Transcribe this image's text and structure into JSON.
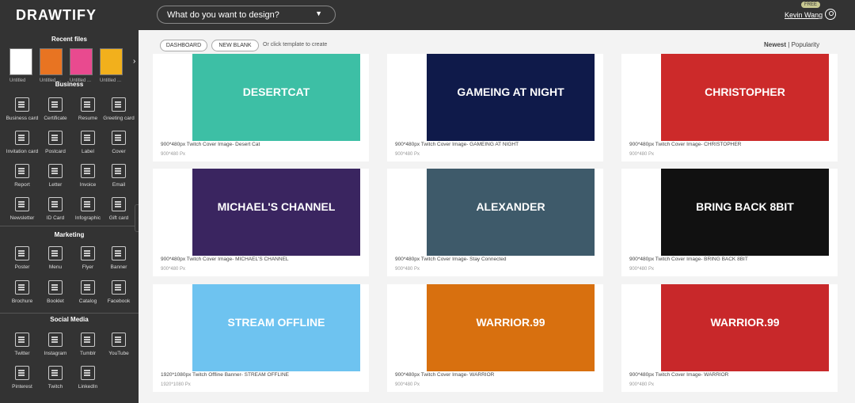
{
  "header": {
    "logo": "DRAWTIFY",
    "search_placeholder": "What do you want to design?",
    "badge": "FREE",
    "user": "Kevin Wang"
  },
  "sidebar": {
    "recent_title": "Recent files",
    "recent_label": "Untitled ...",
    "untitled_short": "Untitled",
    "business": "Business",
    "marketing": "Marketing",
    "social": "Social Media",
    "items": [
      "Business card",
      "Certificate",
      "Resume",
      "Greeting card",
      "Invitation card",
      "Postcard",
      "Label",
      "Cover",
      "Report",
      "Letter",
      "Invoice",
      "Email",
      "Newsletter",
      "ID Card",
      "Infographic",
      "Gift card",
      "Poster",
      "Menu",
      "Flyer",
      "Banner",
      "Brochure",
      "Booklet",
      "Catalog",
      "Facebook",
      "Twitter",
      "Instagram",
      "Tumblr",
      "YouTube",
      "Pinterest",
      "Twitch",
      "LinkedIn"
    ]
  },
  "main": {
    "dashboard": "DASHBOARD",
    "new_blank": "NEW BLANK",
    "or_text": "Or click template to create",
    "newest": "Newest",
    "sep": "|",
    "popularity": "Popularity"
  },
  "cards": [
    {
      "title": "900*480px Twitch Cover Image- Desert Cat",
      "size": "900*480 Px",
      "text": "DESERTCAT",
      "bg": "#3dbfa5"
    },
    {
      "title": "900*480px Twitch Cover Image- GAMEING AT NIGHT",
      "size": "900*480 Px",
      "text": "GAMEING AT NIGHT",
      "bg": "#0f1a4a"
    },
    {
      "title": "900*480px Twitch Cover Image- CHRISTOPHER",
      "size": "900*480 Px",
      "text": "CHRISTOPHER",
      "bg": "#cc2a2a"
    },
    {
      "title": "900*480px Twitch Cover Image- MICHAEL'S CHANNEL",
      "size": "900*480 Px",
      "text": "MICHAEL'S CHANNEL",
      "bg": "#3a2560"
    },
    {
      "title": "900*480px Twitch Cover Image- Stay Connected",
      "size": "900*480 Px",
      "text": "ALEXANDER",
      "bg": "#3e5a6a"
    },
    {
      "title": "900*480px Twitch Cover Image- BRING BACK 8BIT",
      "size": "900*480 Px",
      "text": "BRING BACK 8BIT",
      "bg": "#111"
    },
    {
      "title": "1920*1080px Twitch Offline Banner- STREAM OFFLINE",
      "size": "1920*1080 Px",
      "text": "STREAM OFFLINE",
      "bg": "#6ec3f0"
    },
    {
      "title": "900*480px Twitch Cover Image- WARRIOR",
      "size": "900*480 Px",
      "text": "WARRIOR.99",
      "bg": "#d8700f"
    },
    {
      "title": "900*480px Twitch Cover Image- WARRIOR",
      "size": "900*480 Px",
      "text": "WARRIOR.99",
      "bg": "#c8282a"
    }
  ]
}
